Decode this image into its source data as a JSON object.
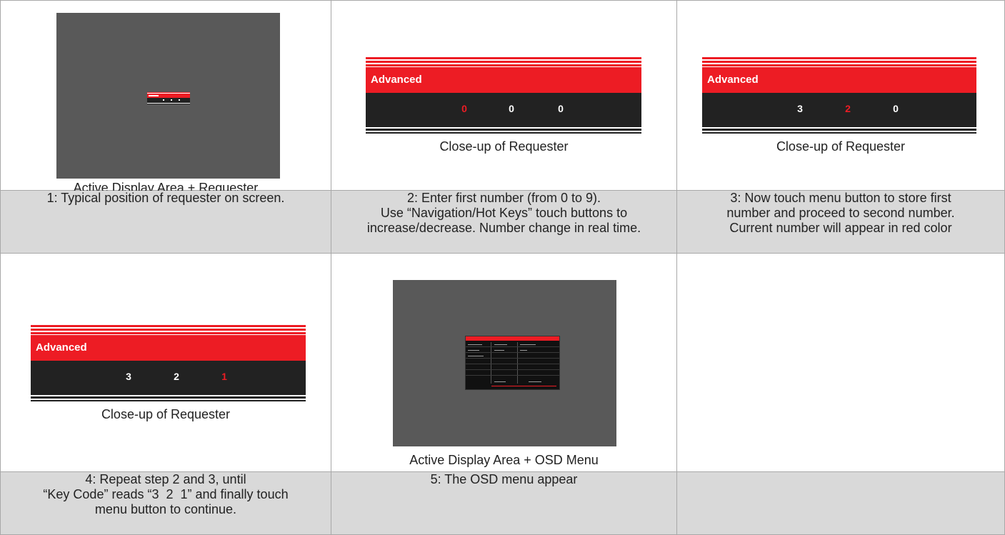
{
  "panels": {
    "p1": {
      "caption": "Active Display Area + Requester"
    },
    "p2": {
      "title": "Advanced",
      "digits": [
        "0",
        "0",
        "0"
      ],
      "active_index": 0,
      "caption": "Close-up of Requester"
    },
    "p3": {
      "title": "Advanced",
      "digits": [
        "3",
        "2",
        "0"
      ],
      "active_index": 1,
      "caption": "Close-up of Requester"
    },
    "p4": {
      "title": "Advanced",
      "digits": [
        "3",
        "2",
        "1"
      ],
      "active_index": 2,
      "caption": "Close-up of Requester"
    },
    "p5": {
      "caption": "Active Display Area + OSD Menu"
    }
  },
  "steps": {
    "s1": [
      "1: Typical position of requester on screen."
    ],
    "s2": [
      "2: Enter first number (from 0 to 9).",
      "Use “Navigation/Hot Keys” touch buttons to",
      "increase/decrease. Number change in real time."
    ],
    "s3": [
      "3: Now touch menu button to store first",
      "number and proceed to second number.",
      "Current number will appear in red color"
    ],
    "s4": [
      "4: Repeat step 2 and 3, until",
      "“Key Code” reads “3  2  1” and finally touch",
      "menu button to continue."
    ],
    "s5": [
      "5: The OSD menu appear"
    ]
  },
  "colors": {
    "accent_red": "#ed1c24",
    "bar_dark": "#222222",
    "display_grey": "#595959",
    "step_row_bg": "#d9d9d9"
  }
}
